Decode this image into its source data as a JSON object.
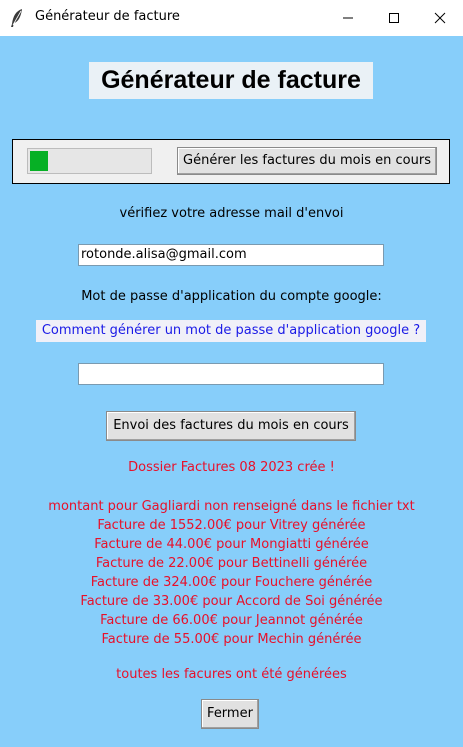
{
  "window": {
    "title": "Générateur de facture",
    "icon": "feather-icon",
    "controls": [
      "minimize-icon",
      "maximize-icon",
      "close-icon"
    ]
  },
  "main": {
    "heading": "Générateur de facture",
    "progress": {
      "value": 0.15
    },
    "generate_button": "Générer les factures du mois en cours",
    "email_label": "vérifiez votre adresse mail d'envoi",
    "email_value": "rotonde.alisa@gmail.com",
    "password_label": "Mot de passe d'application du compte google:",
    "help_link": "Comment générer un mot de passe d'application google ?",
    "password_value": "",
    "send_button": "Envoi des factures du mois en cours",
    "close_button": "Fermer"
  },
  "log": {
    "folder_created": "Dossier Factures 08 2023 crée !",
    "lines": [
      "montant pour Gagliardi non renseigné dans le fichier txt",
      "Facture de 1552.00€ pour Vitrey générée",
      "Facture de 44.00€ pour Mongiatti générée",
      "Facture de 22.00€ pour Bettinelli générée",
      "Facture de 324.00€ pour Fouchere générée",
      "Facture de 33.00€ pour Accord de Soi générée",
      "Facture de 66.00€ pour Jeannot générée",
      "Facture de 55.00€ pour Mechin générée"
    ],
    "done": "toutes les facures ont été générées"
  },
  "colors": {
    "background": "#87cefa",
    "log_text": "#e8102a",
    "link_text": "#1a1ae6",
    "progress_fill": "#06b025"
  }
}
